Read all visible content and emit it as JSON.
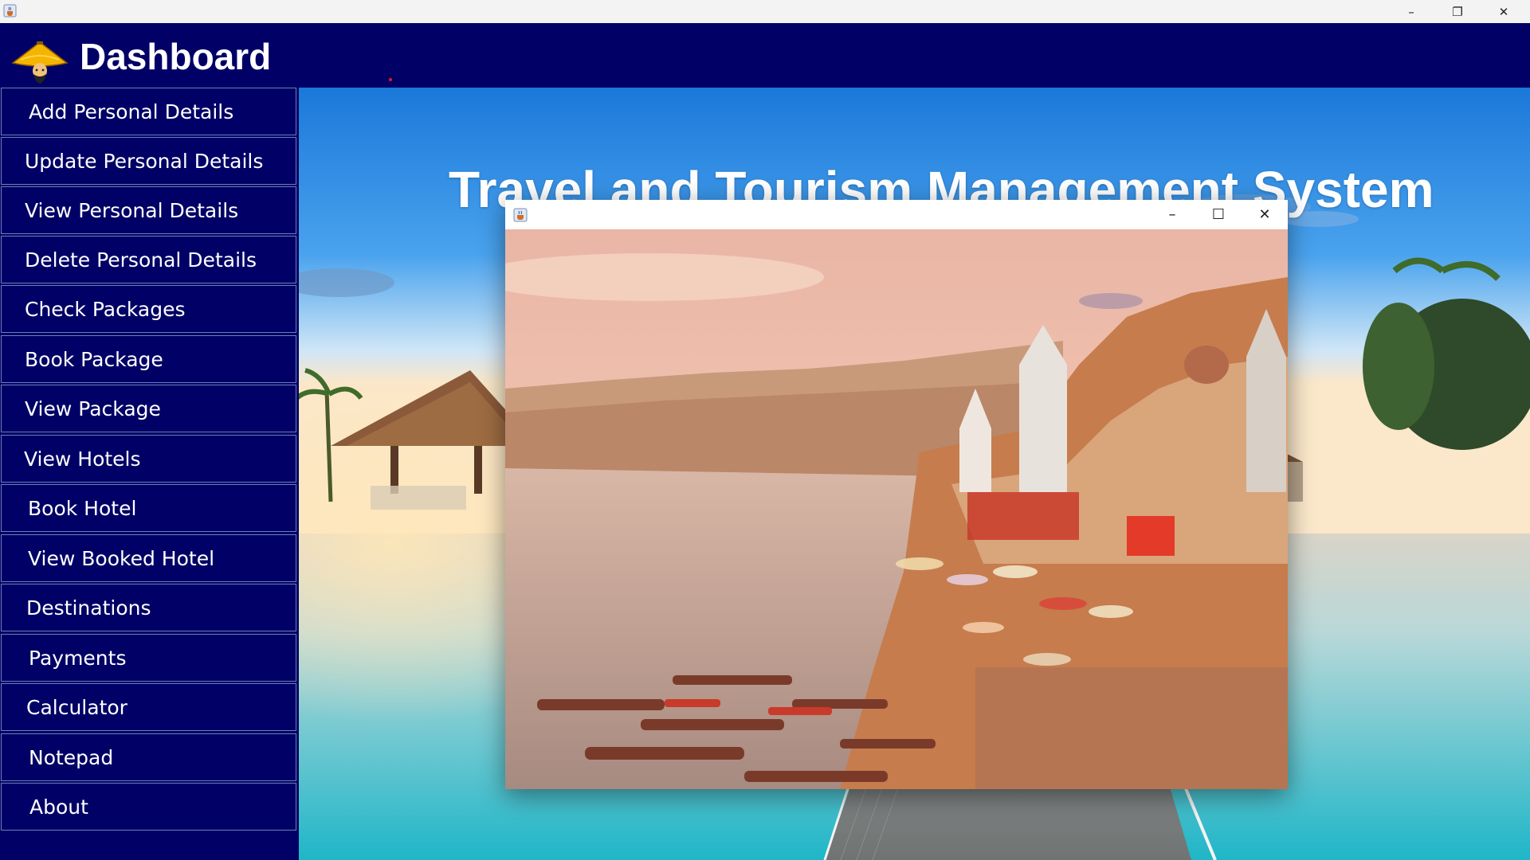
{
  "os_window": {
    "app_icon": "java-cup-icon",
    "controls": {
      "minimize": "–",
      "maximize": "❐",
      "close": "✕"
    }
  },
  "header": {
    "title": "Dashboard",
    "logo": "traveler-hat-icon",
    "background_color": "#000066"
  },
  "sidebar": {
    "items": [
      {
        "label": "Add Personal Details"
      },
      {
        "label": "Update Personal Details"
      },
      {
        "label": "View Personal Details"
      },
      {
        "label": "Delete Personal Details"
      },
      {
        "label": "Check Packages"
      },
      {
        "label": "Book Package"
      },
      {
        "label": "View Package"
      },
      {
        "label": "View Hotels"
      },
      {
        "label": "Book Hotel"
      },
      {
        "label": "View Booked Hotel"
      },
      {
        "label": "Destinations"
      },
      {
        "label": "Payments"
      },
      {
        "label": "Calculator"
      },
      {
        "label": "Notepad"
      },
      {
        "label": "About"
      }
    ]
  },
  "main": {
    "heading": "Travel and Tourism Management System",
    "background_image": "beach-resort-pier-scene"
  },
  "child_window": {
    "app_icon": "java-cup-icon",
    "controls": {
      "minimize": "–",
      "maximize": "☐",
      "close": "✕"
    },
    "image": "varanasi-ghats-river-scene"
  },
  "colors": {
    "navy": "#000066",
    "button_border": "#6f7fb8",
    "text": "#ffffff"
  }
}
